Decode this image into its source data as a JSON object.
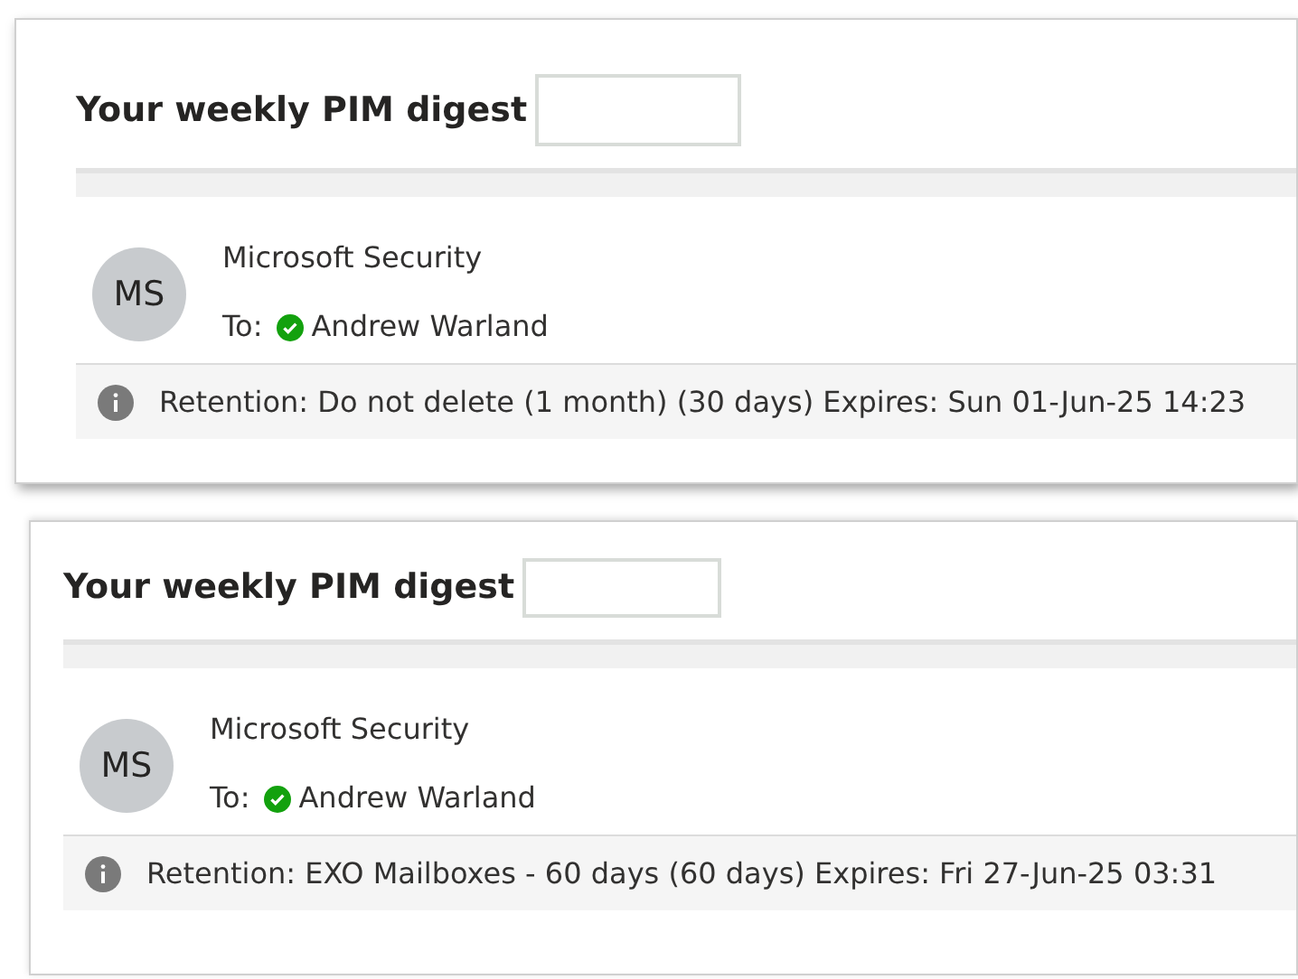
{
  "messages": [
    {
      "subject": "Your weekly PIM digest",
      "avatar": "MS",
      "sender": "Microsoft Security",
      "to_label": "To:",
      "recipient": "Andrew Warland",
      "retention": "Retention: Do not delete (1 month) (30 days) Expires: Sun 01-Jun-25 14:23"
    },
    {
      "subject": "Your weekly PIM digest",
      "avatar": "MS",
      "sender": "Microsoft Security",
      "to_label": "To:",
      "recipient": "Andrew Warland",
      "retention": "Retention: EXO Mailboxes - 60 days (60 days) Expires: Fri 27-Jun-25 03:31"
    }
  ]
}
